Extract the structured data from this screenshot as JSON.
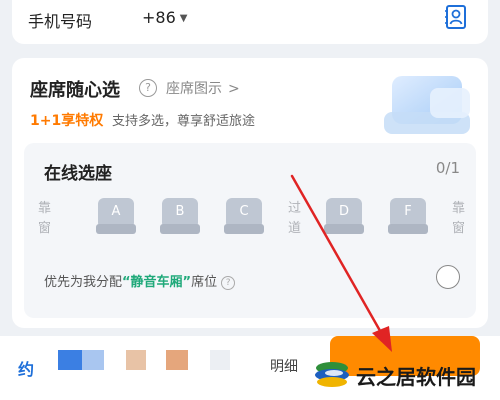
{
  "phone": {
    "label": "手机号码",
    "country_code": "+86",
    "caret": "▼",
    "contacts_icon": "contacts-icon"
  },
  "seat_selection": {
    "title": "座席随心选",
    "help_glyph": "?",
    "diagram_link": "座席图示",
    "diagram_chevron": ">",
    "privilege": "1+1享特权",
    "privilege_desc": "支持多选，尊享舒适旅途",
    "online": {
      "title": "在线选座",
      "count": "0/1",
      "window_left": "靠窗",
      "aisle": "过道",
      "window_right": "靠窗",
      "seats": [
        "A",
        "B",
        "C",
        "D",
        "F"
      ],
      "assign_prefix": "优先为我分配",
      "assign_highlight": "“静音车厢”",
      "assign_suffix": "席位",
      "assign_help_glyph": "?"
    }
  },
  "bottom_bar": {
    "left_label": "约",
    "detail": "明细"
  },
  "watermark": {
    "text": "云之居软件园"
  },
  "colors": {
    "accent_orange": "#ff8a00",
    "privilege_orange": "#ff7a00",
    "quiet_green": "#1fa97a",
    "arrow_red": "#e02424",
    "link_blue": "#1e6fd9"
  }
}
